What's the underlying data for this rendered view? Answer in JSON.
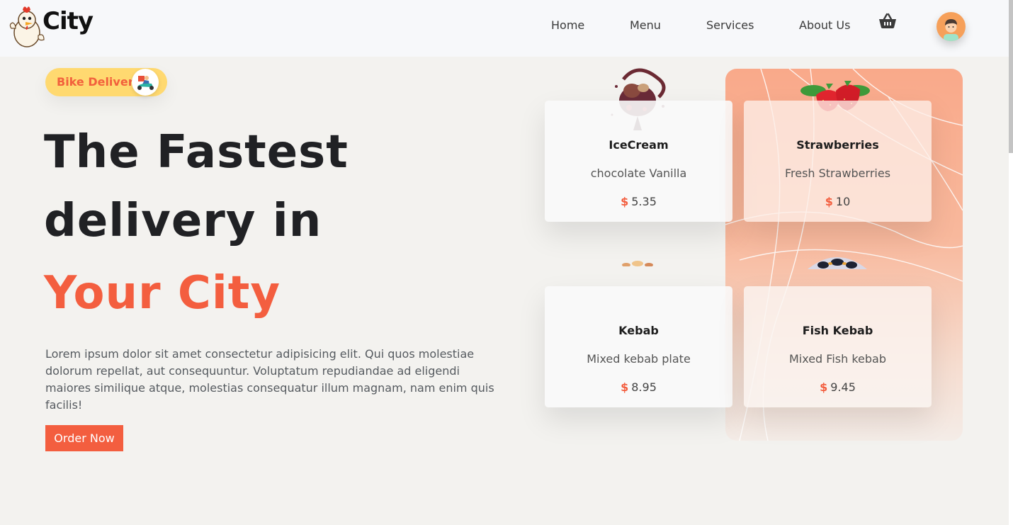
{
  "header": {
    "brand": "City",
    "nav": [
      "Home",
      "Menu",
      "Services",
      "About Us"
    ]
  },
  "hero": {
    "badge_label": "Bike Delivery",
    "title_line1": "The Fastest",
    "title_line2": "delivery in",
    "title_line3": "Your City",
    "description": "Lorem ipsum dolor sit amet consectetur adipisicing elit. Qui quos molestiae dolorum repellat, aut consequuntur. Voluptatum repudiandae ad eligendi maiores similique atque, molestias consequatur illum magnam, nam enim quis facilis!",
    "cta_label": "Order Now"
  },
  "cards": [
    {
      "name": "IceCream",
      "desc": "chocolate Vanilla",
      "currency": "$",
      "price": "5.35"
    },
    {
      "name": "Strawberries",
      "desc": "Fresh Strawberries",
      "currency": "$",
      "price": "10"
    },
    {
      "name": "Kebab",
      "desc": "Mixed kebab plate",
      "currency": "$",
      "price": "8.95"
    },
    {
      "name": "Fish Kebab",
      "desc": "Mixed Fish kebab",
      "currency": "$",
      "price": "9.45"
    }
  ],
  "colors": {
    "accent": "#f35e3f",
    "badge_bg": "#ffd970",
    "panel": "#f9a98a",
    "text": "#202124"
  },
  "icons": [
    "chicken-logo-icon",
    "shopping-basket-icon",
    "user-avatar-icon",
    "scooter-delivery-icon"
  ]
}
